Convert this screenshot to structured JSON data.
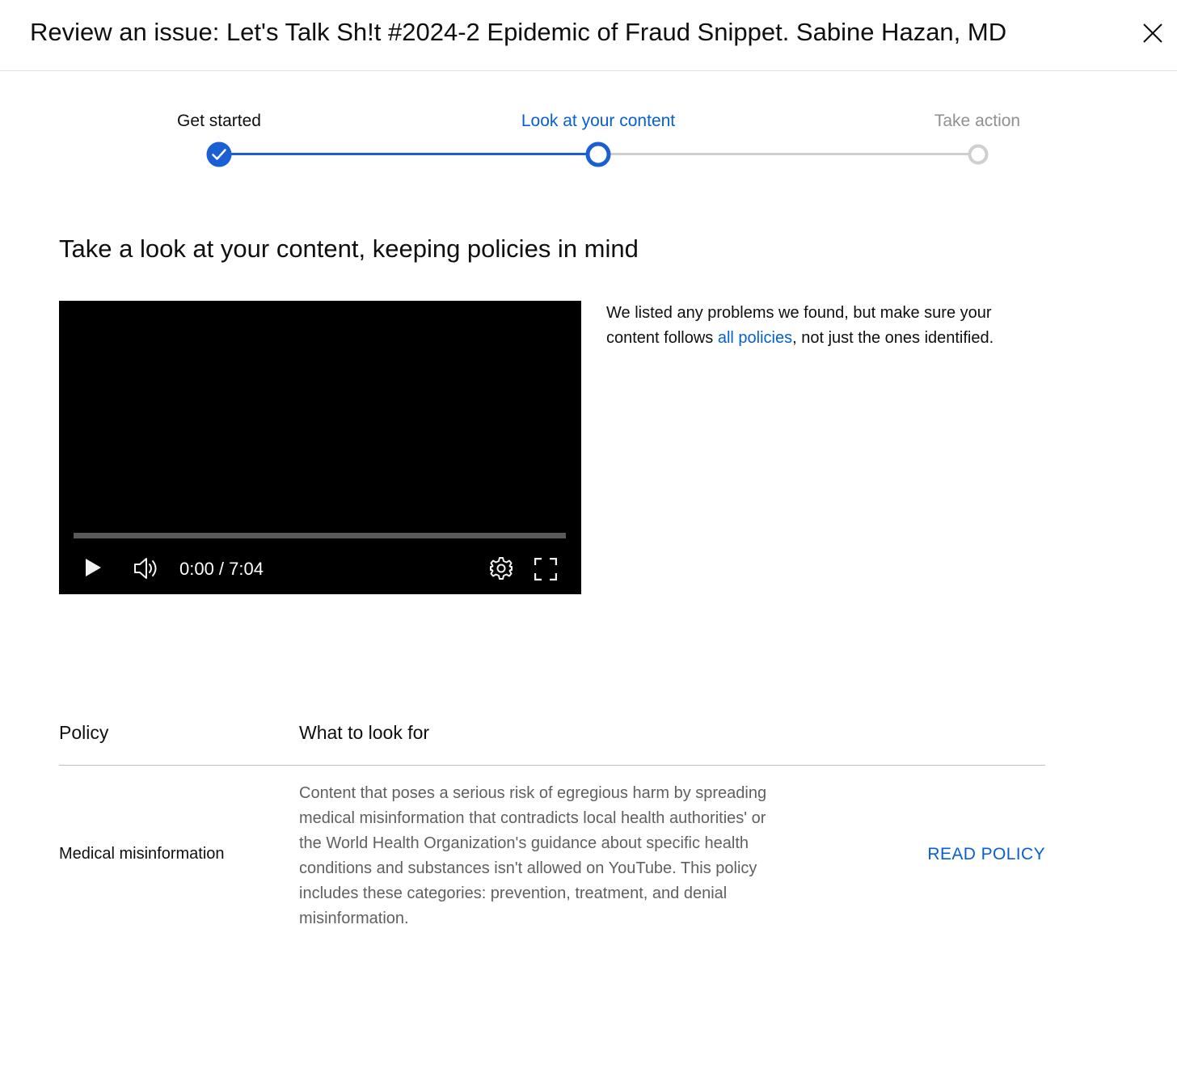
{
  "header": {
    "title": "Review an issue: Let's Talk Sh!t #2024-2 Epidemic of Fraud Snippet. Sabine Hazan, MD",
    "close_icon": "close-icon"
  },
  "stepper": {
    "steps": [
      {
        "label": "Get started",
        "state": "completed"
      },
      {
        "label": "Look at your content",
        "state": "current"
      },
      {
        "label": "Take action",
        "state": "upcoming"
      }
    ]
  },
  "main": {
    "heading": "Take a look at your content, keeping policies in mind",
    "notice": {
      "before_link": "We listed any problems we found, but make sure your content follows ",
      "link_text": "all policies",
      "after_link": ", not just the ones identified."
    }
  },
  "player": {
    "current_time": "0:00",
    "duration": "7:04",
    "time_text": "0:00 / 7:04",
    "progress_fraction": 0,
    "icons": [
      "play-icon",
      "volume-icon",
      "settings-icon",
      "fullscreen-icon"
    ]
  },
  "policy_table": {
    "headers": {
      "policy": "Policy",
      "what_to_look_for": "What to look for"
    },
    "rows": [
      {
        "policy": "Medical misinformation",
        "description": "Content that poses a serious risk of egregious harm by spreading medical misinformation that contradicts local health authorities' or the World Health Organization's guidance about specific health conditions and substances isn't allowed on YouTube. This policy includes these categories: prevention, treatment, and denial misinformation.",
        "action_label": "READ POLICY"
      }
    ]
  },
  "colors": {
    "accent": "#065fd4",
    "stepper_blue": "#1a5fd4",
    "inactive_gray": "#cfcfcf",
    "secondary_text": "#606060"
  }
}
